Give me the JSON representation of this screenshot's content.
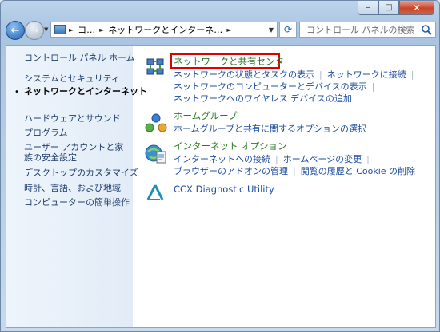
{
  "window": {
    "caption_buttons": {
      "minimize": "–",
      "maximize": "□",
      "close": "✕"
    }
  },
  "address_bar": {
    "crumbs": [
      "コ…",
      "ネットワークとインターネ…"
    ]
  },
  "search": {
    "placeholder": "コントロール パネルの検索"
  },
  "sidebar": {
    "items": [
      {
        "label": "コントロール パネル ホーム"
      },
      {
        "label": "システムとセキュリティ"
      },
      {
        "label": "ネットワークとインターネット",
        "active": true
      },
      {
        "label": "ハードウェアとサウンド"
      },
      {
        "label": "プログラム"
      },
      {
        "label": "ユーザー アカウントと家族の安全設定"
      },
      {
        "label": "デスクトップのカスタマイズ"
      },
      {
        "label": "時計、言語、および地域"
      },
      {
        "label": "コンピューターの簡単操作"
      }
    ]
  },
  "categories": [
    {
      "title": "ネットワークと共有センター",
      "icon": "network-sharing-icon",
      "links": [
        [
          "ネットワークの状態とタスクの表示",
          "ネットワークに接続"
        ],
        [
          "ネットワークのコンピューターとデバイスの表示"
        ],
        [
          "ネットワークへのワイヤレス デバイスの追加"
        ]
      ]
    },
    {
      "title": "ホームグループ",
      "icon": "homegroup-icon",
      "links": [
        [
          "ホームグループと共有に関するオプションの選択"
        ]
      ]
    },
    {
      "title": "インターネット オプション",
      "icon": "internet-options-icon",
      "links": [
        [
          "インターネットへの接続",
          "ホームページの変更"
        ],
        [
          "ブラウザーのアドオンの管理",
          "閲覧の履歴と Cookie の削除"
        ]
      ]
    },
    {
      "title": "CCX Diagnostic Utility",
      "icon": "ccx-icon",
      "links": []
    }
  ],
  "colors": {
    "highlight": "#e00000",
    "category_title": "#2b7a25",
    "link": "#1f4ea0"
  }
}
